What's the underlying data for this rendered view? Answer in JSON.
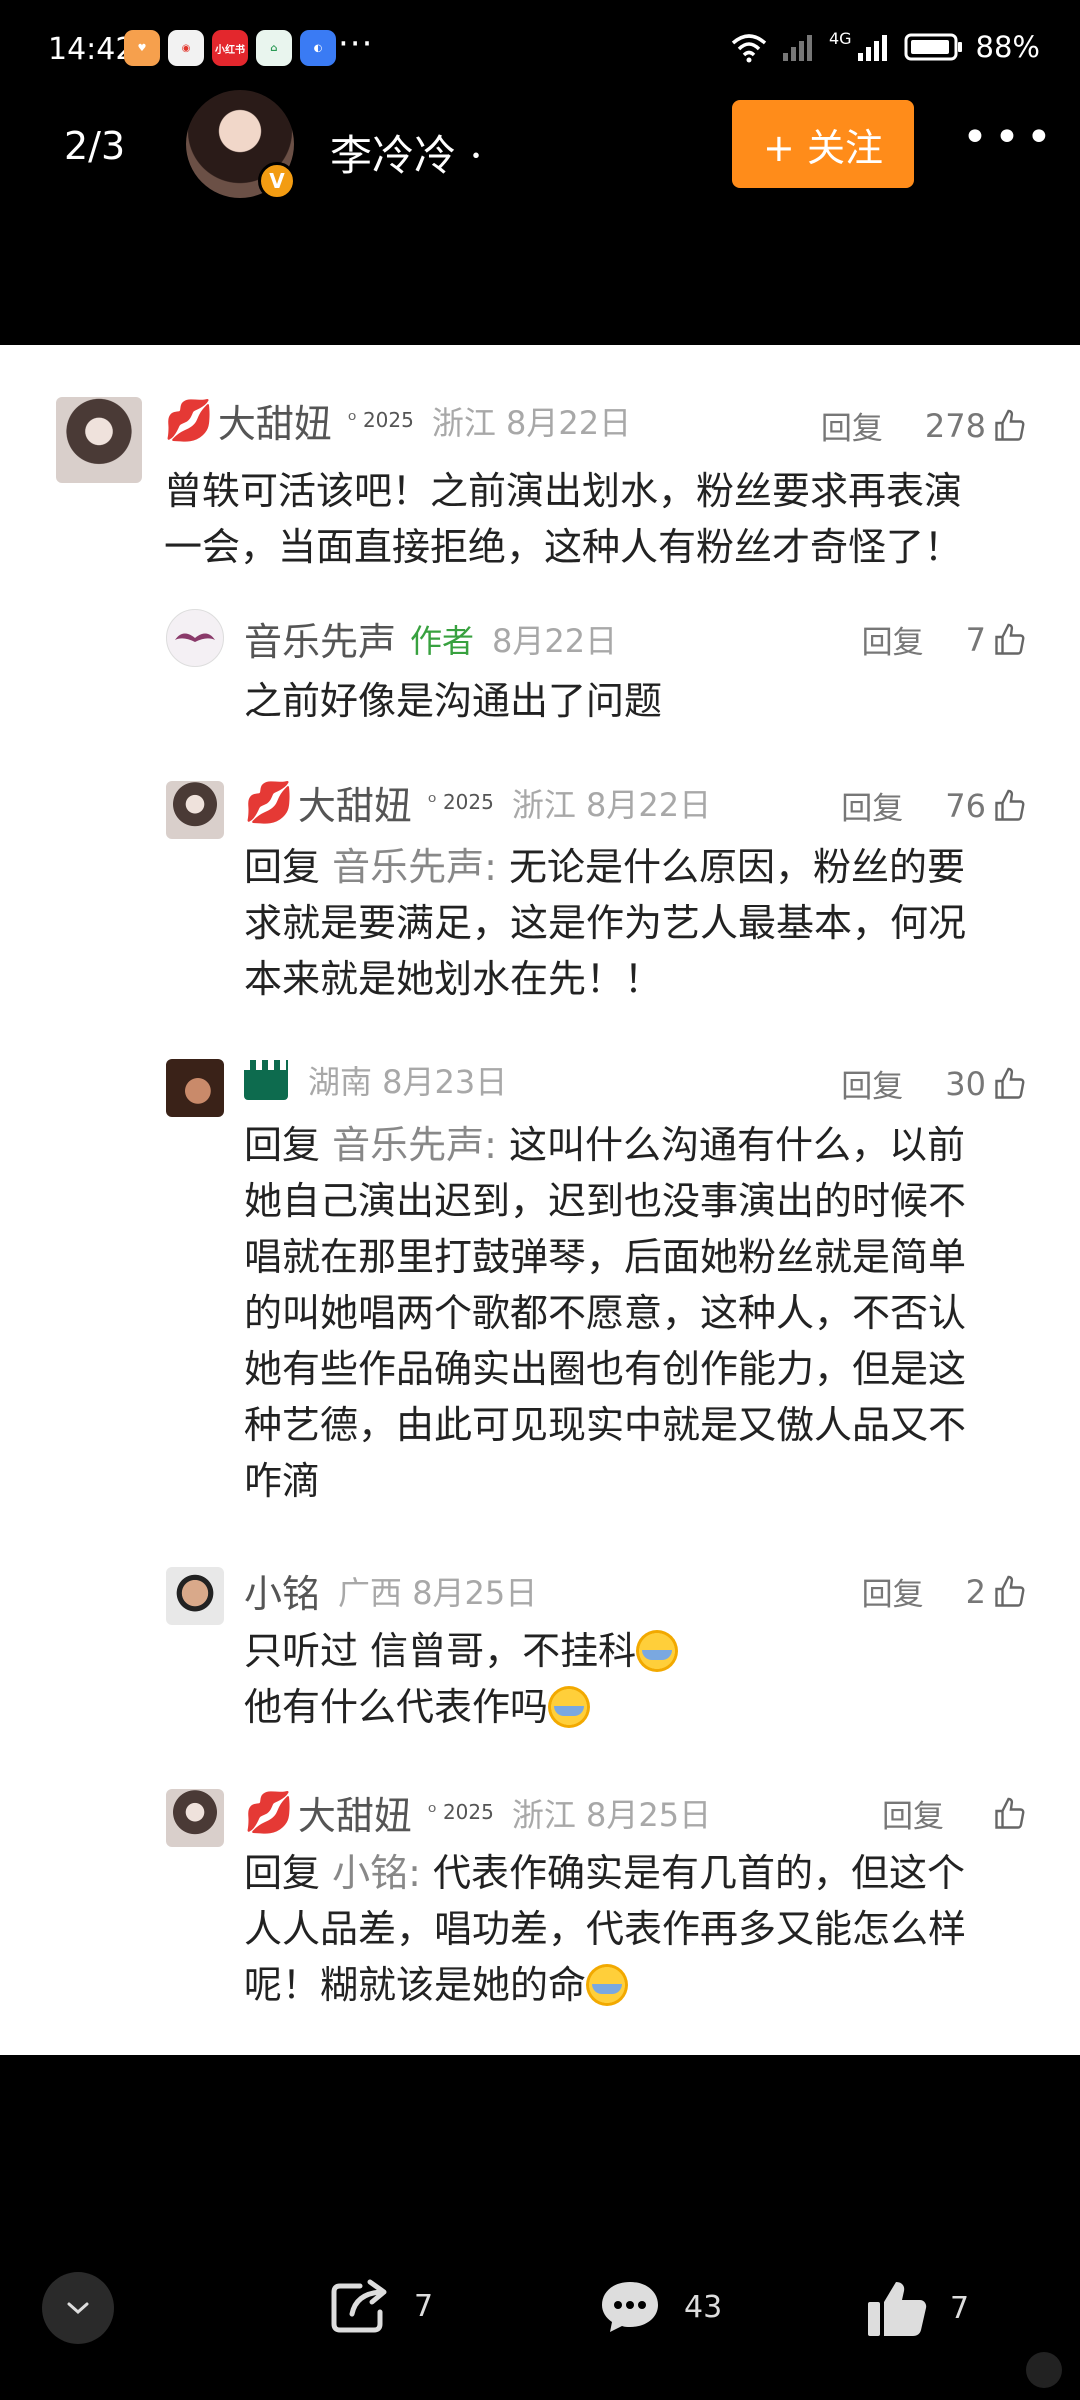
{
  "status_bar": {
    "time": "14:42",
    "apps": [
      {
        "icon": "heart-app-icon",
        "color": "#f6a04d",
        "label": ""
      },
      {
        "icon": "weibo-app-icon",
        "color": "#f2f2f2",
        "label": ""
      },
      {
        "icon": "xiaohongshu-app-icon",
        "color": "#e3272d",
        "label": "小红书"
      },
      {
        "icon": "home-app-icon",
        "color": "#e9f5ee",
        "label": ""
      },
      {
        "icon": "browser-app-icon",
        "color": "#3a7bf4",
        "label": ""
      }
    ],
    "more": "···",
    "signal_label": "4G",
    "battery": "88%"
  },
  "header": {
    "page_indicator": "2/3",
    "user_name": "李冷冷 ·",
    "verified": "V",
    "follow_label": "+ 关注",
    "more": "•••"
  },
  "comments": [
    {
      "name": "大甜妞",
      "badge": "2025",
      "location_date": "浙江 8月22日",
      "reply_label": "回复",
      "likes": "278",
      "text_lines": [
        "曾轶可活该吧！之前演出划水，粉丝要求再表演",
        "一会，当面直接拒绝，这种人有粉丝才奇怪了！"
      ]
    },
    {
      "name": "音乐先声",
      "author_tag": "作者",
      "location_date": "8月22日",
      "reply_label": "回复",
      "likes": "7",
      "text_lines": [
        "之前好像是沟通出了问题"
      ]
    },
    {
      "name": "大甜妞",
      "badge": "2025",
      "location_date": "浙江 8月22日",
      "reply_label": "回复",
      "likes": "76",
      "reply_prefix": "回复 ",
      "reply_target": "音乐先声:",
      "text_lines": [
        " 无论是什么原因，粉丝的要",
        "求就是要满足，这是作为艺人最基本，何况",
        "本来就是她划水在先！！"
      ]
    },
    {
      "location_date": "湖南 8月23日",
      "reply_label": "回复",
      "likes": "30",
      "reply_prefix": "回复 ",
      "reply_target": "音乐先声:",
      "text_lines": [
        " 这叫什么沟通有什么，以前",
        "她自己演出迟到，迟到也没事演出的时候不",
        "唱就在那里打鼓弹琴，后面她粉丝就是简单",
        "的叫她唱两个歌都不愿意，这种人，不否认",
        "她有些作品确实出圈也有创作能力，但是这",
        "种艺德，由此可见现实中就是又傲人品又不",
        "咋滴"
      ]
    },
    {
      "name": "小铭",
      "location_date": "广西 8月25日",
      "reply_label": "回复",
      "likes": "2",
      "text_lines": [
        "只听过 信曾哥，不挂科",
        "他有什么代表作吗"
      ]
    },
    {
      "name": "大甜妞",
      "badge": "2025",
      "location_date": "浙江 8月25日",
      "reply_label": "回复",
      "likes": "",
      "reply_prefix": "回复 ",
      "reply_target": "小铭:",
      "text_lines": [
        " 代表作确实是有几首的，但这个",
        "人人品差，唱功差，代表作再多又能怎么样",
        "呢！糊就该是她的命"
      ]
    }
  ],
  "bottom_bar": {
    "share_count": "7",
    "comment_count": "43",
    "like_count": "7"
  }
}
